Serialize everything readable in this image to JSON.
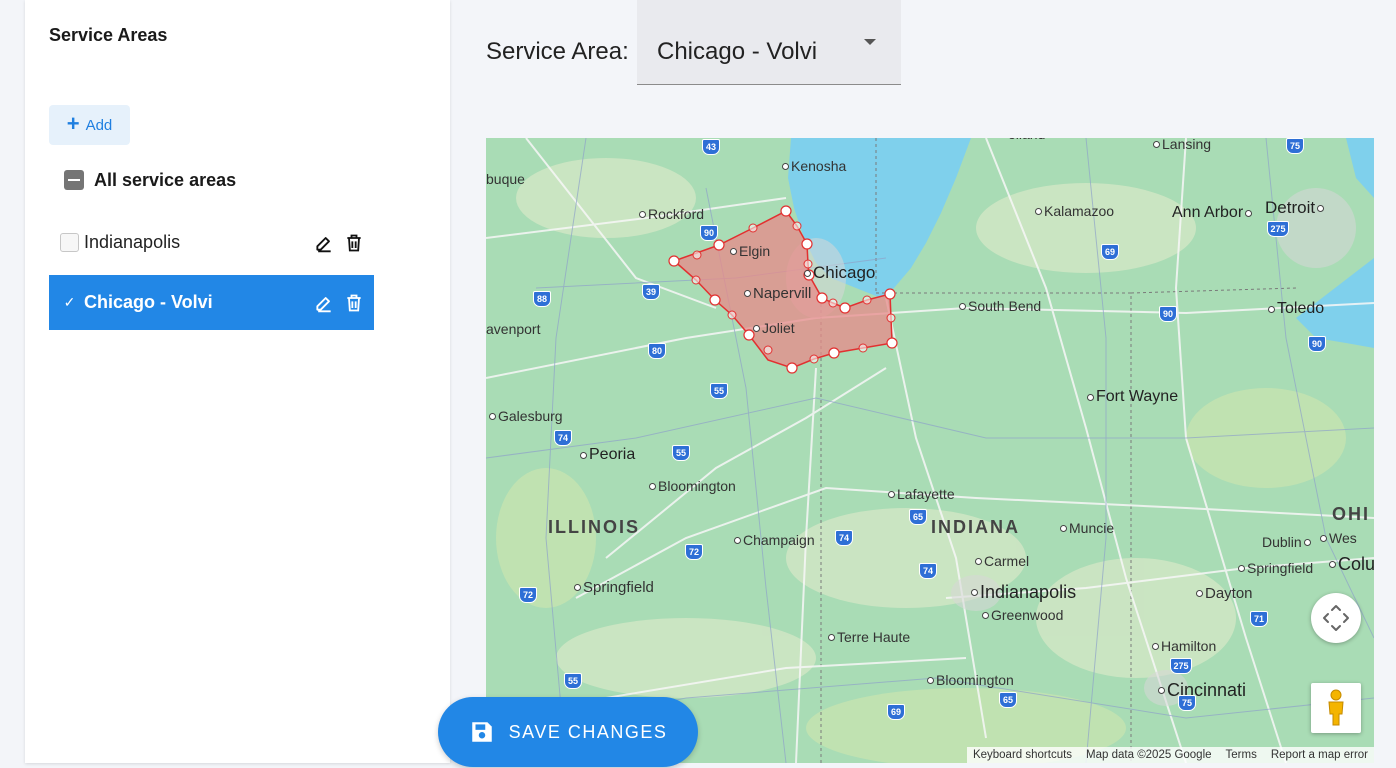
{
  "sidebar": {
    "title": "Service Areas",
    "add_label": "Add",
    "all_label": "All service areas",
    "areas": [
      {
        "label": "Indianapolis",
        "checked": false,
        "selected": false
      },
      {
        "label": "Chicago - Volvi",
        "checked": true,
        "selected": true
      }
    ]
  },
  "header": {
    "label": "Service Area:",
    "selected_value": "Chicago - Volvi"
  },
  "map": {
    "cities": {
      "kenosha": "Kenosha",
      "rockford": "Rockford",
      "elgin": "Elgin",
      "chicago": "Chicago",
      "naperville": "Napervill",
      "joliet": "Joliet",
      "davenport": "avenport",
      "dubuque": "buque",
      "lansing": "Lansing",
      "kalamazoo": "Kalamazoo",
      "ann_arbor": "Ann Arbor",
      "detroit": "Detroit",
      "toledo": "Toledo",
      "south_bend": "South Bend",
      "fort_wayne": "Fort Wayne",
      "galesburg": "Galesburg",
      "peoria": "Peoria",
      "bloomington_il": "Bloomington",
      "champaign": "Champaign",
      "springfield_il": "Springfield",
      "lafayette": "Lafayette",
      "muncie": "Muncie",
      "carmel": "Carmel",
      "indianapolis": "Indianapolis",
      "greenwood": "Greenwood",
      "terre_haute": "Terre Haute",
      "bloomington_in": "Bloomington",
      "dublin": "Dublin",
      "springfield_oh": "Springfield",
      "columbus_partial": "Colu",
      "dayton": "Dayton",
      "hamilton": "Hamilton",
      "cincinnati": "Cincinnati",
      "west_partial": "Wes",
      "holland_partial": "olland"
    },
    "states": {
      "illinois": "ILLINOIS",
      "indiana": "INDIANA",
      "ohio_partial": "OHI"
    },
    "shields": [
      "43",
      "90",
      "39",
      "88",
      "80",
      "55",
      "74",
      "55",
      "72",
      "72",
      "55",
      "69",
      "90",
      "90",
      "275",
      "75",
      "74",
      "65",
      "74",
      "65",
      "69",
      "71",
      "275",
      "75"
    ],
    "attribution": {
      "shortcuts": "Keyboard shortcuts",
      "data": "Map data ©2025 Google",
      "terms": "Terms",
      "report": "Report a map error"
    },
    "colors": {
      "land": "#a9dcb5",
      "water": "#7fd0ec",
      "polygon_fill": "#e88a8a",
      "polygon_stroke": "#e23030"
    }
  },
  "save_label": "SAVE CHANGES",
  "colors": {
    "accent": "#2287e6",
    "add_bg": "#e6f1fb"
  }
}
